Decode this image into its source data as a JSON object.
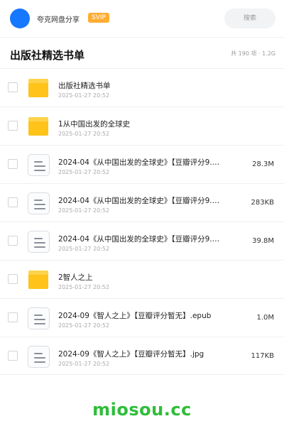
{
  "header": {
    "user_name": "夸克网盘分享",
    "badge": "SVIP",
    "search_placeholder": "搜索"
  },
  "folder": {
    "title": "出版社精选书单",
    "meta": "共 190 项 · 1.2G"
  },
  "files": [
    {
      "name": "出版社精选书单",
      "date": "2025-01-27 20:52",
      "size": "",
      "type": "folder"
    },
    {
      "name": "1从中国出发的全球史",
      "date": "2025-01-27 20:52",
      "size": "",
      "type": "folder"
    },
    {
      "name": "2024-04《从中国出发的全球史》【豆瓣评分9.…",
      "date": "2025-01-27 20:52",
      "size": "28.3M",
      "type": "document"
    },
    {
      "name": "2024-04《从中国出发的全球史》【豆瓣评分9.…",
      "date": "2025-01-27 20:52",
      "size": "283KB",
      "type": "document"
    },
    {
      "name": "2024-04《从中国出发的全球史》【豆瓣评分9.…",
      "date": "2025-01-27 20:52",
      "size": "39.8M",
      "type": "document"
    },
    {
      "name": "2智人之上",
      "date": "2025-01-27 20:52",
      "size": "",
      "type": "folder"
    },
    {
      "name": "2024-09《智人之上》【豆瓣评分暂无】.epub",
      "date": "2025-01-27 20:52",
      "size": "1.0M",
      "type": "document"
    },
    {
      "name": "2024-09《智人之上》【豆瓣评分暂无】.jpg",
      "date": "2025-01-27 20:52",
      "size": "117KB",
      "type": "document"
    }
  ],
  "watermark": "miosou.cc",
  "colors": {
    "accent": "#1677ff",
    "badge": "#ffad33",
    "folder": "#ffc31a",
    "watermark": "#2fbd3a"
  }
}
